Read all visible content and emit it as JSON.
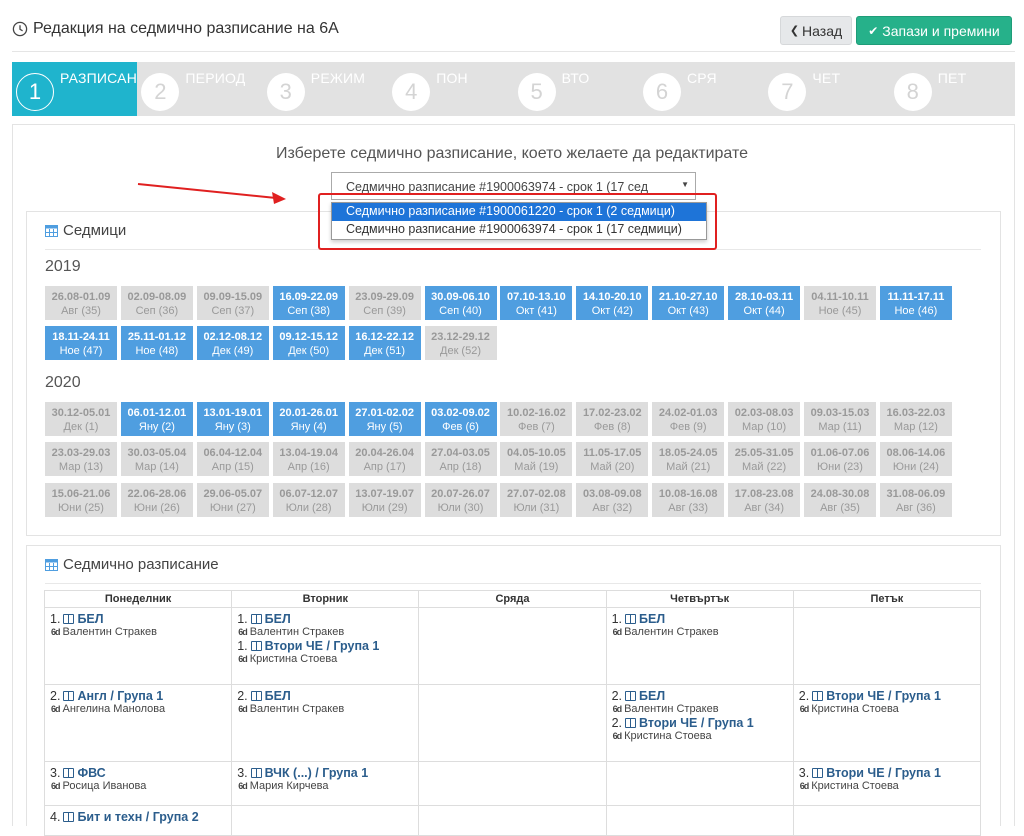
{
  "header": {
    "title": "Редакция на седмично разписание на 6А",
    "back_label": "Назад",
    "save_label": "Запази и премини"
  },
  "wizard": {
    "steps": [
      {
        "num": "1",
        "label": "РАЗПИСАН",
        "active": true
      },
      {
        "num": "2",
        "label": "ПЕРИОД",
        "active": false
      },
      {
        "num": "3",
        "label": "РЕЖИМ",
        "active": false
      },
      {
        "num": "4",
        "label": "ПОН",
        "active": false
      },
      {
        "num": "5",
        "label": "ВТО",
        "active": false
      },
      {
        "num": "6",
        "label": "СРЯ",
        "active": false
      },
      {
        "num": "7",
        "label": "ЧЕТ",
        "active": false
      },
      {
        "num": "8",
        "label": "ПЕТ",
        "active": false
      }
    ]
  },
  "selector": {
    "caption": "Изберете седмично разписание, което желаете да редактирате",
    "current_value": "Седмично разписание #1900063974 - срок 1 (17 сед",
    "options": [
      "Седмично разписание #1900061220 - срок 1 (2 седмици)",
      "Седмично разписание #1900063974 - срок 1 (17 седмици)"
    ],
    "highlighted_option": 0
  },
  "weeks": {
    "title": "Седмици",
    "years": [
      {
        "year": "2019",
        "items": [
          {
            "dates": "26.08-01.09",
            "month": "Авг (35)",
            "on": false
          },
          {
            "dates": "02.09-08.09",
            "month": "Сеп (36)",
            "on": false
          },
          {
            "dates": "09.09-15.09",
            "month": "Сеп (37)",
            "on": false
          },
          {
            "dates": "16.09-22.09",
            "month": "Сеп (38)",
            "on": true
          },
          {
            "dates": "23.09-29.09",
            "month": "Сеп (39)",
            "on": false
          },
          {
            "dates": "30.09-06.10",
            "month": "Сеп (40)",
            "on": true
          },
          {
            "dates": "07.10-13.10",
            "month": "Окт (41)",
            "on": true
          },
          {
            "dates": "14.10-20.10",
            "month": "Окт (42)",
            "on": true
          },
          {
            "dates": "21.10-27.10",
            "month": "Окт (43)",
            "on": true
          },
          {
            "dates": "28.10-03.11",
            "month": "Окт (44)",
            "on": true
          },
          {
            "dates": "04.11-10.11",
            "month": "Ное (45)",
            "on": false
          },
          {
            "dates": "11.11-17.11",
            "month": "Ное (46)",
            "on": true
          },
          {
            "dates": "18.11-24.11",
            "month": "Ное (47)",
            "on": true
          },
          {
            "dates": "25.11-01.12",
            "month": "Ное (48)",
            "on": true
          },
          {
            "dates": "02.12-08.12",
            "month": "Дек (49)",
            "on": true
          },
          {
            "dates": "09.12-15.12",
            "month": "Дек (50)",
            "on": true
          },
          {
            "dates": "16.12-22.12",
            "month": "Дек (51)",
            "on": true
          },
          {
            "dates": "23.12-29.12",
            "month": "Дек (52)",
            "on": false
          }
        ]
      },
      {
        "year": "2020",
        "items": [
          {
            "dates": "30.12-05.01",
            "month": "Дек (1)",
            "on": false
          },
          {
            "dates": "06.01-12.01",
            "month": "Яну (2)",
            "on": true
          },
          {
            "dates": "13.01-19.01",
            "month": "Яну (3)",
            "on": true
          },
          {
            "dates": "20.01-26.01",
            "month": "Яну (4)",
            "on": true
          },
          {
            "dates": "27.01-02.02",
            "month": "Яну (5)",
            "on": true
          },
          {
            "dates": "03.02-09.02",
            "month": "Фев (6)",
            "on": true
          },
          {
            "dates": "10.02-16.02",
            "month": "Фев (7)",
            "on": false
          },
          {
            "dates": "17.02-23.02",
            "month": "Фев (8)",
            "on": false
          },
          {
            "dates": "24.02-01.03",
            "month": "Фев (9)",
            "on": false
          },
          {
            "dates": "02.03-08.03",
            "month": "Мар (10)",
            "on": false
          },
          {
            "dates": "09.03-15.03",
            "month": "Мар (11)",
            "on": false
          },
          {
            "dates": "16.03-22.03",
            "month": "Мар (12)",
            "on": false
          },
          {
            "dates": "23.03-29.03",
            "month": "Мар (13)",
            "on": false
          },
          {
            "dates": "30.03-05.04",
            "month": "Мар (14)",
            "on": false
          },
          {
            "dates": "06.04-12.04",
            "month": "Апр (15)",
            "on": false
          },
          {
            "dates": "13.04-19.04",
            "month": "Апр (16)",
            "on": false
          },
          {
            "dates": "20.04-26.04",
            "month": "Апр (17)",
            "on": false
          },
          {
            "dates": "27.04-03.05",
            "month": "Апр (18)",
            "on": false
          },
          {
            "dates": "04.05-10.05",
            "month": "Май (19)",
            "on": false
          },
          {
            "dates": "11.05-17.05",
            "month": "Май (20)",
            "on": false
          },
          {
            "dates": "18.05-24.05",
            "month": "Май (21)",
            "on": false
          },
          {
            "dates": "25.05-31.05",
            "month": "Май (22)",
            "on": false
          },
          {
            "dates": "01.06-07.06",
            "month": "Юни (23)",
            "on": false
          },
          {
            "dates": "08.06-14.06",
            "month": "Юни (24)",
            "on": false
          },
          {
            "dates": "15.06-21.06",
            "month": "Юни (25)",
            "on": false
          },
          {
            "dates": "22.06-28.06",
            "month": "Юни (26)",
            "on": false
          },
          {
            "dates": "29.06-05.07",
            "month": "Юни (27)",
            "on": false
          },
          {
            "dates": "06.07-12.07",
            "month": "Юли (28)",
            "on": false
          },
          {
            "dates": "13.07-19.07",
            "month": "Юли (29)",
            "on": false
          },
          {
            "dates": "20.07-26.07",
            "month": "Юли (30)",
            "on": false
          },
          {
            "dates": "27.07-02.08",
            "month": "Юли (31)",
            "on": false
          },
          {
            "dates": "03.08-09.08",
            "month": "Авг (32)",
            "on": false
          },
          {
            "dates": "10.08-16.08",
            "month": "Авг (33)",
            "on": false
          },
          {
            "dates": "17.08-23.08",
            "month": "Авг (34)",
            "on": false
          },
          {
            "dates": "24.08-30.08",
            "month": "Авг (35)",
            "on": false
          },
          {
            "dates": "31.08-06.09",
            "month": "Авг (36)",
            "on": false
          }
        ]
      }
    ]
  },
  "schedule": {
    "title": "Седмично разписание",
    "days": [
      "Понеделник",
      "Вторник",
      "Сряда",
      "Четвъртък",
      "Петък"
    ],
    "rows": [
      [
        [
          {
            "n": "1.",
            "subject": "БЕЛ",
            "teacher": "Валентин Стракев"
          }
        ],
        [
          {
            "n": "1.",
            "subject": "БЕЛ",
            "teacher": "Валентин Стракев"
          },
          {
            "n": "1.",
            "subject": "Втори ЧЕ / Група 1",
            "teacher": "Кристина Стоева"
          }
        ],
        [],
        [
          {
            "n": "1.",
            "subject": "БЕЛ",
            "teacher": "Валентин Стракев"
          }
        ],
        []
      ],
      [
        [
          {
            "n": "2.",
            "subject": "Англ / Група 1",
            "teacher": "Ангелина Манолова"
          }
        ],
        [
          {
            "n": "2.",
            "subject": "БЕЛ",
            "teacher": "Валентин Стракев"
          }
        ],
        [],
        [
          {
            "n": "2.",
            "subject": "БЕЛ",
            "teacher": "Валентин Стракев"
          },
          {
            "n": "2.",
            "subject": "Втори ЧЕ / Група 1",
            "teacher": "Кристина Стоева"
          }
        ],
        [
          {
            "n": "2.",
            "subject": "Втори ЧЕ / Група 1",
            "teacher": "Кристина Стоева"
          }
        ]
      ],
      [
        [
          {
            "n": "3.",
            "subject": "ФВС",
            "teacher": "Росица Иванова"
          }
        ],
        [
          {
            "n": "3.",
            "subject": "ВЧК (...) / Група 1",
            "teacher": "Мария Кирчева"
          }
        ],
        [],
        [],
        [
          {
            "n": "3.",
            "subject": "Втори ЧЕ / Група 1",
            "teacher": "Кристина Стоева"
          }
        ]
      ],
      [
        [
          {
            "n": "4.",
            "subject": "Бит и техн / Група 2",
            "teacher": ""
          }
        ],
        [],
        [],
        [],
        []
      ]
    ]
  },
  "colors": {
    "accent": "#1fb4cd",
    "week_on": "#4f9ee0",
    "save_green": "#26b18a",
    "highlight_red": "#e02020"
  }
}
